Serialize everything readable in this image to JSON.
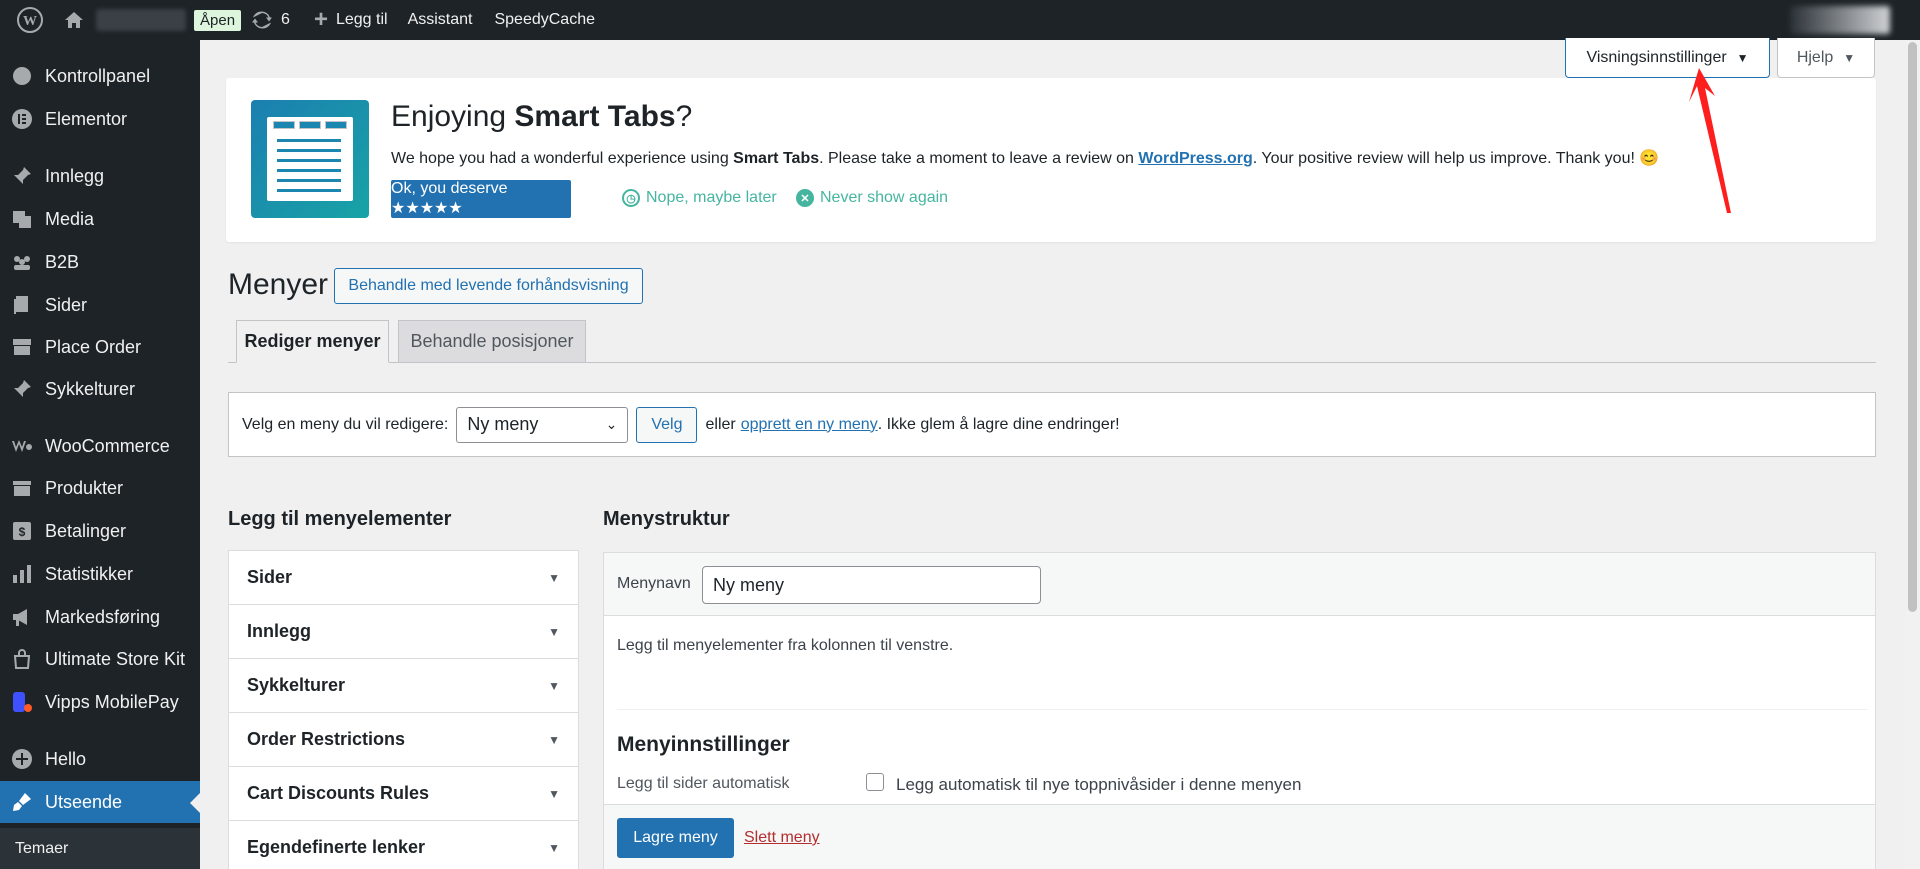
{
  "adminbar": {
    "status": "Åpen",
    "updates_count": "6",
    "add_new": "Legg til",
    "assistant": "Assistant",
    "speedycache": "SpeedyCache"
  },
  "sidebar": {
    "items": [
      {
        "label": "Kontrollpanel",
        "icon": "dashboard-icon"
      },
      {
        "label": "Elementor",
        "icon": "elementor-icon"
      },
      {
        "label": "Innlegg",
        "icon": "pin-icon"
      },
      {
        "label": "Media",
        "icon": "media-icon"
      },
      {
        "label": "B2B",
        "icon": "groups-icon"
      },
      {
        "label": "Sider",
        "icon": "page-icon"
      },
      {
        "label": "Place Order",
        "icon": "store-icon"
      },
      {
        "label": "Sykkelturer",
        "icon": "pin-icon"
      },
      {
        "label": "WooCommerce",
        "icon": "woo-icon"
      },
      {
        "label": "Produkter",
        "icon": "archive-icon"
      },
      {
        "label": "Betalinger",
        "icon": "payment-icon"
      },
      {
        "label": "Statistikker",
        "icon": "chart-icon"
      },
      {
        "label": "Markedsføring",
        "icon": "megaphone-icon"
      },
      {
        "label": "Ultimate Store Kit",
        "icon": "bag-icon"
      },
      {
        "label": "Vipps MobilePay",
        "icon": "vipps-icon"
      },
      {
        "label": "Hello",
        "icon": "plus-circle-icon"
      },
      {
        "label": "Utseende",
        "icon": "brush-icon"
      }
    ],
    "submenu": "Temaer"
  },
  "screen_options": "Visningsinnstillinger",
  "help": "Hjelp",
  "notice": {
    "title_pre": "Enjoying ",
    "title_bold": "Smart Tabs",
    "title_post": "?",
    "text_pre": "We hope you had a wonderful experience using ",
    "text_bold": "Smart Tabs",
    "text_mid": ". Please take a moment to leave a review on ",
    "text_link": "WordPress.org",
    "text_post": ". Your positive review will help us improve. Thank you! 😊",
    "btn": "Ok, you deserve ★★★★★",
    "later": "Nope, maybe later",
    "never": "Never show again"
  },
  "page": {
    "title": "Menyer",
    "live_preview": "Behandle med levende forhåndsvisning",
    "tab_edit": "Rediger menyer",
    "tab_locations": "Behandle posisjoner"
  },
  "select_menu": {
    "label": "Velg en meny du vil redigere:",
    "value": "Ny meny",
    "button": "Velg",
    "or": "eller",
    "create_link": "opprett en ny meny",
    "reminder": ". Ikke glem å lagre dine endringer!"
  },
  "add_items": {
    "heading": "Legg til menyelementer",
    "sections": [
      "Sider",
      "Innlegg",
      "Sykkelturer",
      "Order Restrictions",
      "Cart Discounts Rules",
      "Egendefinerte lenker"
    ]
  },
  "structure": {
    "heading": "Menystruktur",
    "name_label": "Menynavn",
    "name_value": "Ny meny",
    "instructions": "Legg til menyelementer fra kolonnen til venstre.",
    "settings_heading": "Menyinnstillinger",
    "auto_label": "Legg til sider automatisk",
    "auto_checkbox": "Legg automatisk til nye toppnivåsider i denne menyen",
    "save": "Lagre meny",
    "delete": "Slett meny"
  },
  "colors": {
    "accent": "#2271b1",
    "adminbar": "#1d2327",
    "annotation": "#ff1e1e"
  }
}
